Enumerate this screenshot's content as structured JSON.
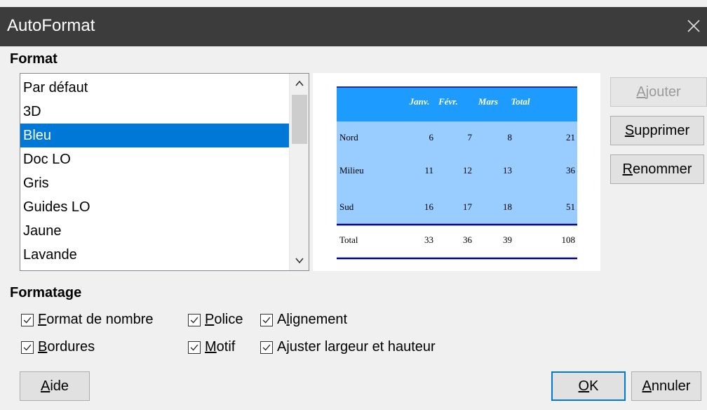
{
  "window": {
    "title": "AutoFormat"
  },
  "sections": {
    "format": "Format",
    "formatage": "Formatage"
  },
  "format_list": {
    "items": [
      "Par défaut",
      "3D",
      "Bleu",
      "Doc LO",
      "Gris",
      "Guides LO",
      "Jaune",
      "Lavande"
    ],
    "selected": "Bleu"
  },
  "preview": {
    "colors": {
      "header": "#1e9bff",
      "body": "#99ccff",
      "border": "#000080"
    },
    "columns": [
      "Janv.",
      "Févr.",
      "Mars",
      "Total"
    ],
    "rows": [
      {
        "label": "Nord",
        "values": [
          "6",
          "7",
          "8",
          "21"
        ]
      },
      {
        "label": "Milieu",
        "values": [
          "11",
          "12",
          "13",
          "36"
        ]
      },
      {
        "label": "Sud",
        "values": [
          "16",
          "17",
          "18",
          "51"
        ]
      }
    ],
    "total_row": {
      "label": "Total",
      "values": [
        "33",
        "36",
        "39",
        "108"
      ]
    }
  },
  "side_buttons": {
    "add": {
      "mnemonic": "A",
      "rest": "jouter",
      "enabled": false
    },
    "delete": {
      "mnemonic": "S",
      "rest": "upprimer"
    },
    "rename": {
      "mnemonic": "R",
      "rest": "enommer"
    }
  },
  "options": {
    "number_format": {
      "pre": "",
      "mnemonic": "F",
      "rest": "ormat de nombre",
      "checked": true
    },
    "font": {
      "pre": "",
      "mnemonic": "P",
      "rest": "olice",
      "checked": true
    },
    "alignment": {
      "pre": "A",
      "mnemonic": "l",
      "rest": "ignement",
      "checked": true
    },
    "borders": {
      "pre": "",
      "mnemonic": "B",
      "rest": "ordures",
      "checked": true
    },
    "pattern": {
      "pre": "",
      "mnemonic": "M",
      "rest": "otif",
      "checked": true
    },
    "autofit": {
      "pre": "A",
      "mnemonic": "j",
      "rest": "uster largeur et hauteur",
      "checked": true
    }
  },
  "bottom_buttons": {
    "help": {
      "mnemonic": "A",
      "rest": "ide"
    },
    "ok": {
      "mnemonic": "O",
      "rest": "K"
    },
    "cancel": {
      "mnemonic": "A",
      "rest": "nnuler"
    }
  },
  "icons": {
    "close": "close-icon",
    "scroll_up": "chevron-up-icon",
    "scroll_down": "chevron-down-icon",
    "checkbox": "checkmark-icon"
  }
}
